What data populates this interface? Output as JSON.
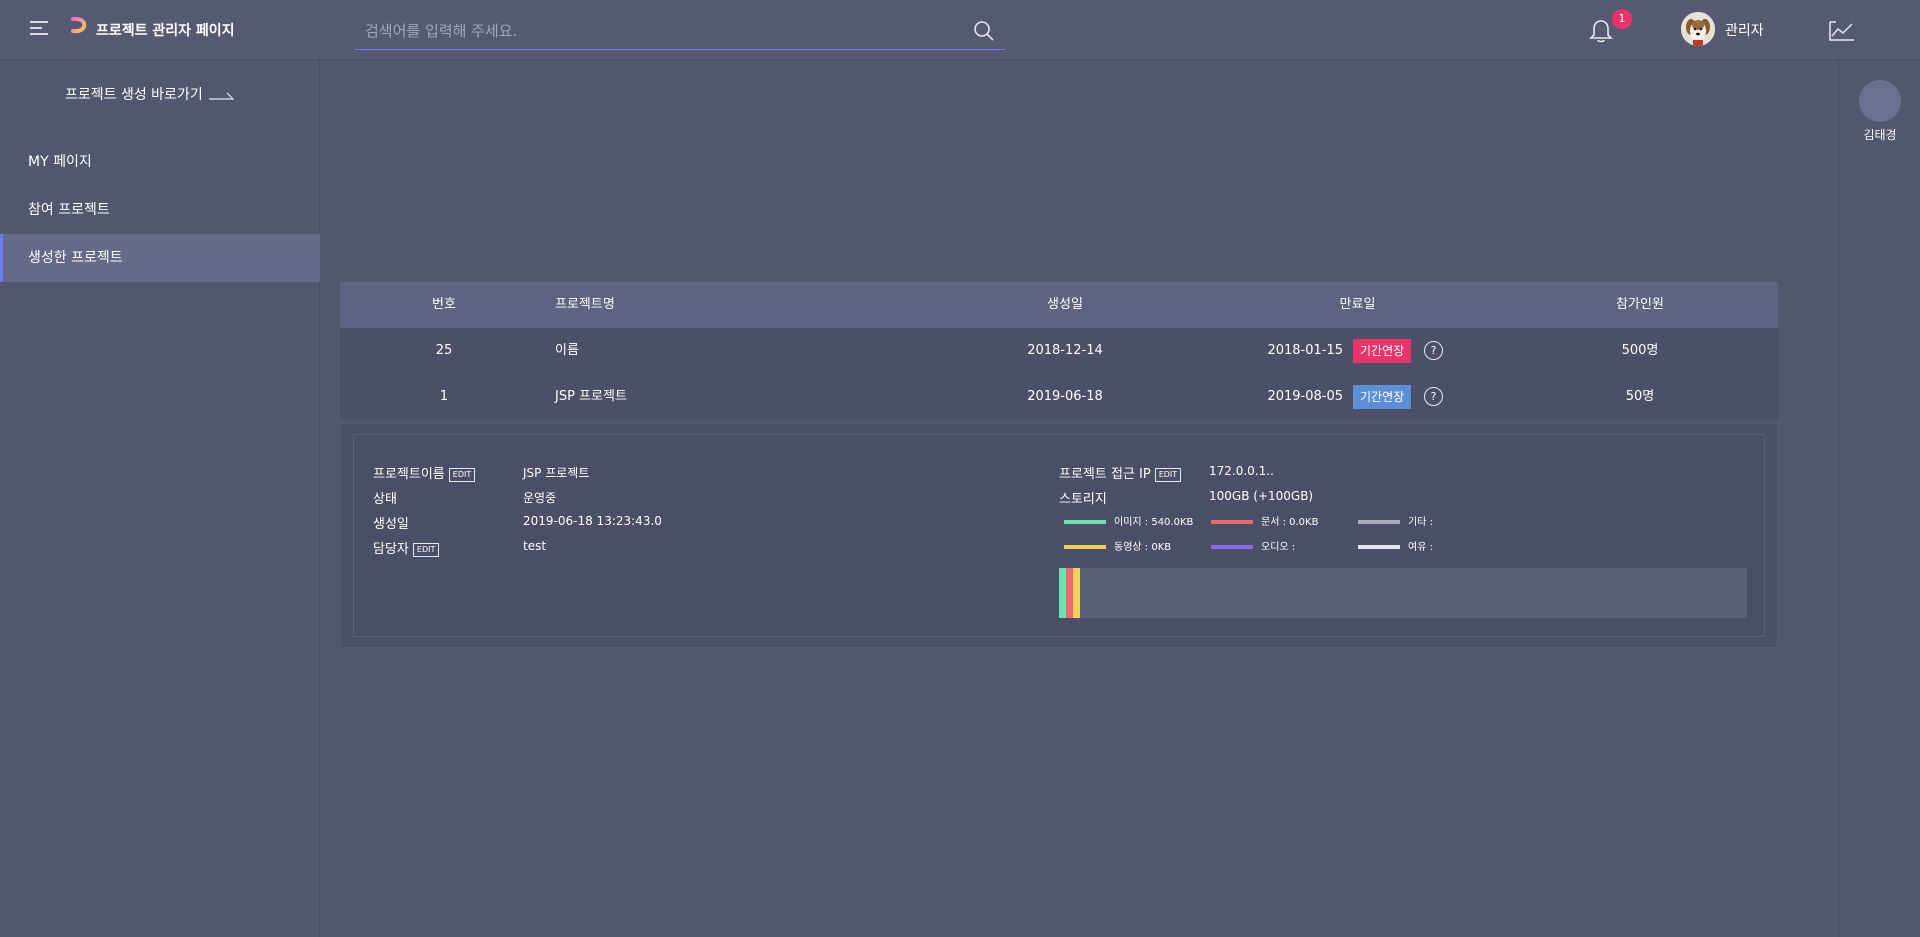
{
  "header": {
    "title": "프로젝트 관리자 페이지",
    "search_placeholder": "검색어를 입력해 주세요.",
    "notification_count": "1",
    "user_name": "관리자"
  },
  "sidebar": {
    "shortcut_label": "프로젝트 생성 바로가기",
    "items": [
      {
        "label": "MY 페이지"
      },
      {
        "label": "참여 프로젝트"
      },
      {
        "label": "생성한 프로젝트"
      }
    ]
  },
  "table": {
    "headers": [
      "번호",
      "프로젝트명",
      "생성일",
      "만료일",
      "참가인원"
    ],
    "rows": [
      {
        "no": "25",
        "name": "이름",
        "created": "2018-12-14",
        "expires": "2018-01-15",
        "extend": "기간연장",
        "members": "500명"
      },
      {
        "no": "1",
        "name": "JSP 프로젝트",
        "created": "2019-06-18",
        "expires": "2019-08-05",
        "extend": "기간연장",
        "members": "50명"
      }
    ],
    "help_symbol": "?"
  },
  "detail": {
    "edit_label": "EDIT",
    "name_label": "프로젝트이름",
    "name_value": "JSP 프로젝트",
    "status_label": "상태",
    "status_value": "운영중",
    "created_label": "생성일",
    "created_value": "2019-06-18 13:23:43.0",
    "manager_label": "담당자",
    "manager_value": "test",
    "ip_label": "프로젝트 접근 IP",
    "ip_value": "172.0.0.1..",
    "storage_label": "스토리지",
    "storage_value": "100GB (+100GB)",
    "legend": [
      {
        "label": "이미지 : 540.0KB",
        "color": "#6ee0b4"
      },
      {
        "label": "문서 : 0.0KB",
        "color": "#e86a6a"
      },
      {
        "label": "기타 :",
        "color": "#a9abb8"
      },
      {
        "label": "동영상 : 0KB",
        "color": "#f2cf5a"
      },
      {
        "label": "오디오 :",
        "color": "#8c6bea"
      },
      {
        "label": "여유 :",
        "color": "#e6e6ee"
      }
    ]
  },
  "right_panel": {
    "user_name": "김태경"
  }
}
